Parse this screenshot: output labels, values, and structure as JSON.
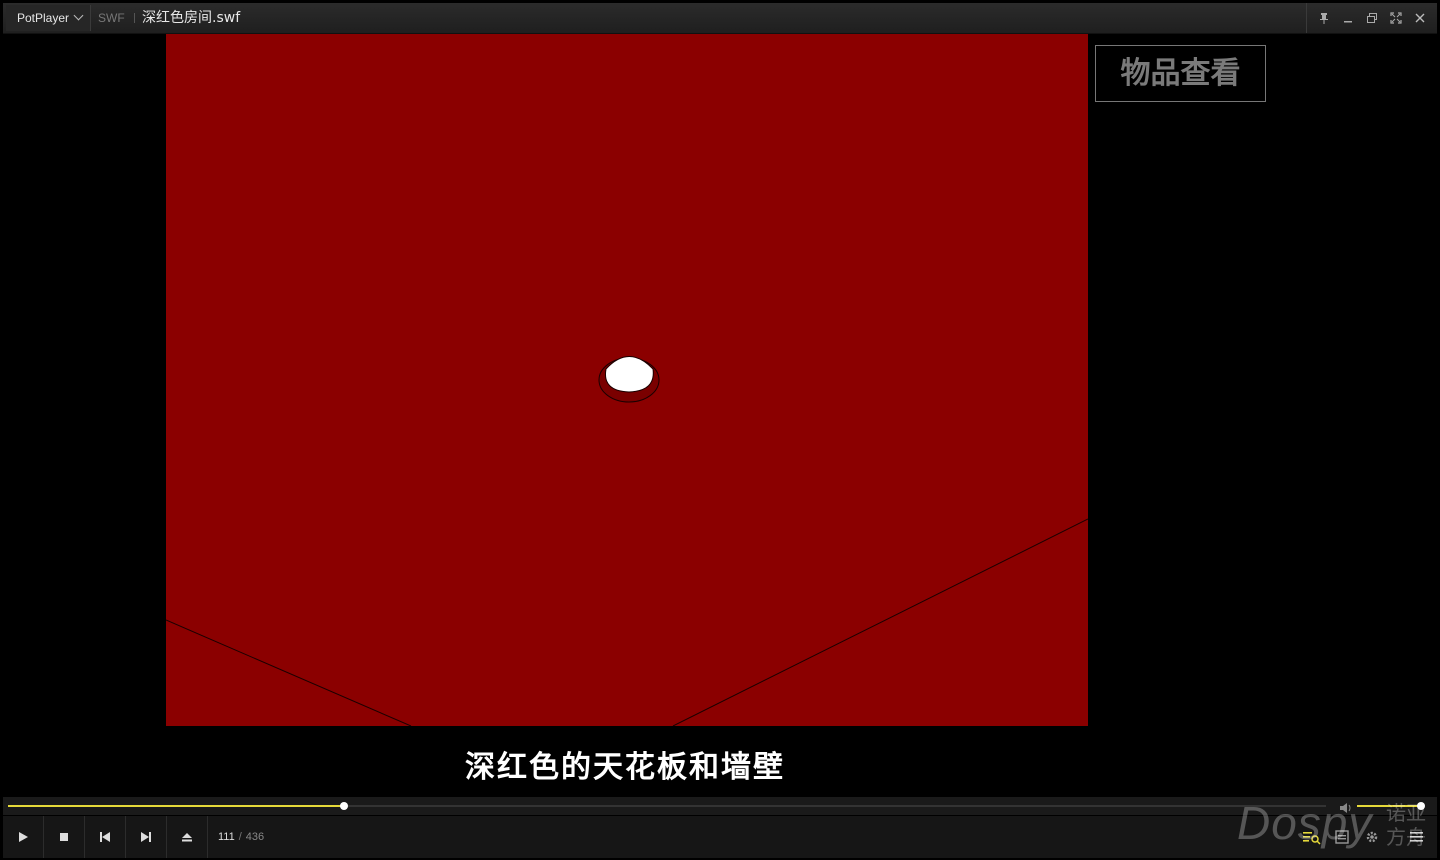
{
  "titlebar": {
    "app_name": "PotPlayer",
    "format": "SWF",
    "filename": "深红色房间.swf",
    "buttons": [
      "pin-icon",
      "minimize-icon",
      "restore-icon",
      "fullscreen-icon",
      "close-icon"
    ]
  },
  "video": {
    "background": "#8b0000",
    "items_button_label": "物品查看",
    "subtitle": "深红色的天花板和墙壁"
  },
  "playback": {
    "progress_fraction": 0.255,
    "volume_fraction": 0.95,
    "current_frame": "111",
    "total_frames": "436",
    "accent_color": "#e6d93a"
  },
  "controls": [
    "play-icon",
    "stop-icon",
    "previous-icon",
    "next-icon",
    "eject-icon"
  ],
  "right_controls": [
    "playlist-icon",
    "chapter-icon",
    "settings-icon",
    "menu-icon"
  ],
  "watermark": {
    "text": "Dospy",
    "cn_text": "诺亚方舟"
  }
}
